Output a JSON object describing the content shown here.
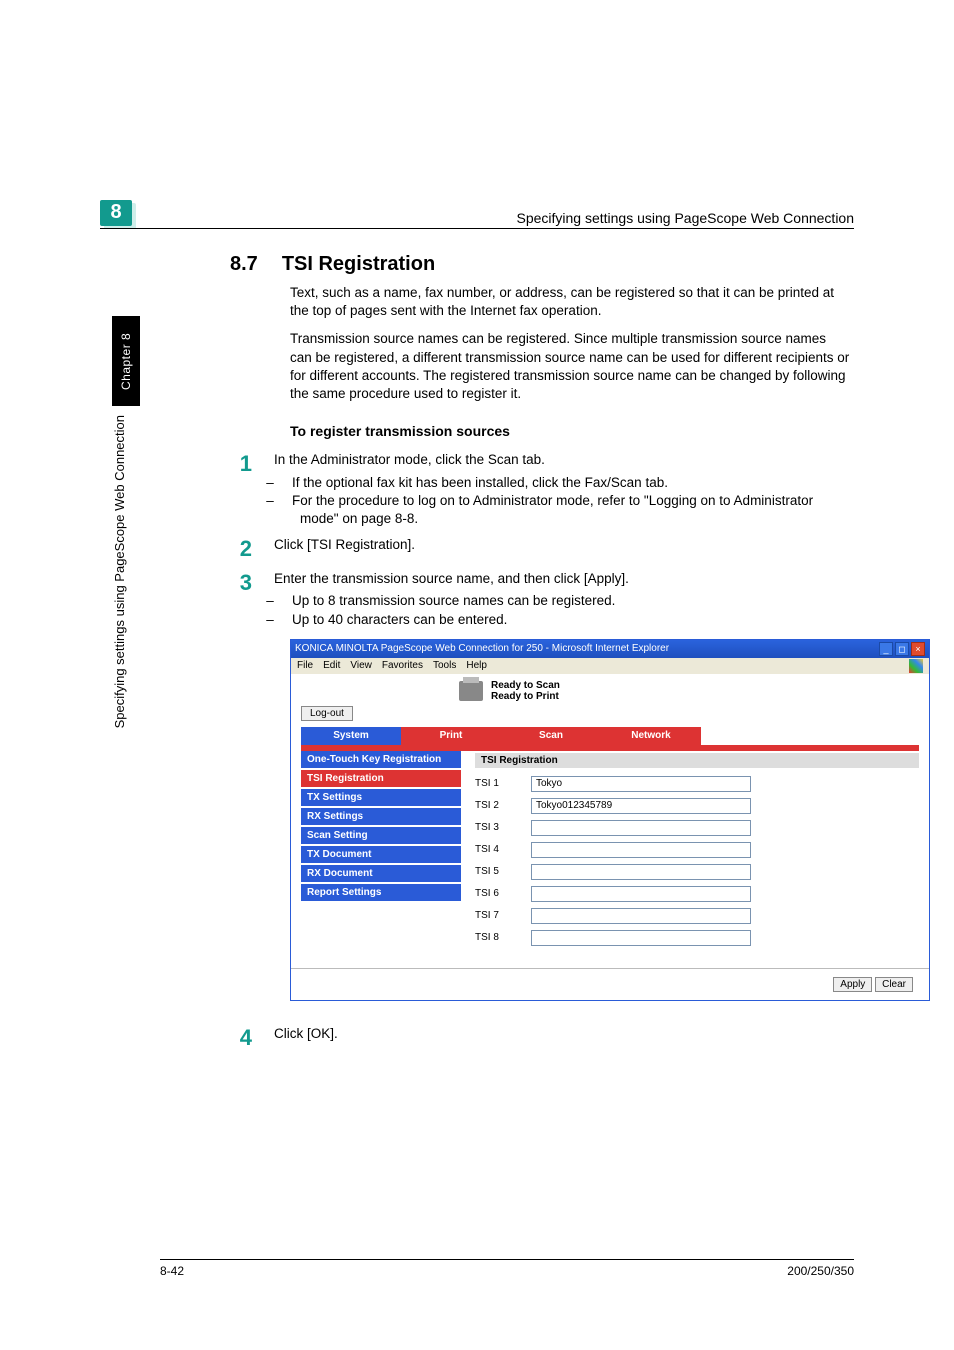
{
  "header": {
    "chapter_num": "8",
    "title": "Specifying settings using PageScope Web Connection"
  },
  "side": {
    "tab": "Chapter 8",
    "text": "Specifying settings using PageScope Web Connection"
  },
  "section": {
    "num": "8.7",
    "title": "TSI Registration"
  },
  "paragraphs": {
    "p1": "Text, such as a name, fax number, or address, can be registered so that it can be printed at the top of pages sent with the Internet fax operation.",
    "p2": "Transmission source names can be registered. Since multiple transmission source names can be registered, a different transmission source name can be used for different recipients or for different accounts. The registered transmission source name can be changed by following the same procedure used to register it."
  },
  "subheading": "To register transmission sources",
  "steps": {
    "s1": {
      "num": "1",
      "text": "In the Administrator mode, click the Scan tab.",
      "subs": [
        "If the optional fax kit has been installed, click the Fax/Scan tab.",
        "For the procedure to log on to Administrator mode, refer to \"Logging on to Administrator mode\" on page 8-8."
      ]
    },
    "s2": {
      "num": "2",
      "text": "Click [TSI Registration]."
    },
    "s3": {
      "num": "3",
      "text": "Enter the transmission source name, and then click [Apply].",
      "subs": [
        "Up to 8 transmission source names can be registered.",
        "Up to 40 characters can be entered."
      ]
    },
    "s4": {
      "num": "4",
      "text": "Click [OK]."
    }
  },
  "screenshot": {
    "window_title": "KONICA MINOLTA PageScope Web Connection for 250 - Microsoft Internet Explorer",
    "menus": [
      "File",
      "Edit",
      "View",
      "Favorites",
      "Tools",
      "Help"
    ],
    "ready_scan": "Ready to Scan",
    "ready_print": "Ready to Print",
    "logout": "Log-out",
    "tabs": {
      "system": "System",
      "print": "Print",
      "scan": "Scan",
      "network": "Network"
    },
    "nav": [
      "One-Touch Key Registration",
      "TSI Registration",
      "TX Settings",
      "RX Settings",
      "Scan Setting",
      "TX Document",
      "RX Document",
      "Report Settings"
    ],
    "pane_title": "TSI Registration",
    "rows": [
      {
        "label": "TSI 1",
        "value": "Tokyo"
      },
      {
        "label": "TSI 2",
        "value": "Tokyo012345789"
      },
      {
        "label": "TSI 3",
        "value": ""
      },
      {
        "label": "TSI 4",
        "value": ""
      },
      {
        "label": "TSI 5",
        "value": ""
      },
      {
        "label": "TSI 6",
        "value": ""
      },
      {
        "label": "TSI 7",
        "value": ""
      },
      {
        "label": "TSI 8",
        "value": ""
      }
    ],
    "apply": "Apply",
    "clear": "Clear"
  },
  "footer": {
    "left": "8-42",
    "right": "200/250/350"
  }
}
